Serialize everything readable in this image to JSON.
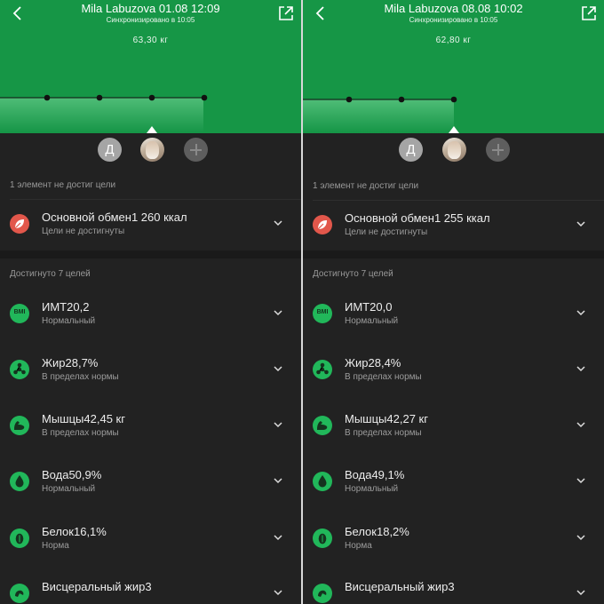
{
  "colors": {
    "header_green": "#169646",
    "goal_green": "#21b75a",
    "alert_red": "#e2574b",
    "background": "#222222"
  },
  "panels": [
    {
      "title": "Mila Labuzova 01.08 12:09",
      "sync": "Синхронизировано в 10:05",
      "weight": "63,30 кг",
      "avatar_initial": "Д",
      "not_reached_label": "1 элемент не достиг цели",
      "reached_label": "Достигнуто 7 целей",
      "alert": {
        "title": "Основной обмен",
        "value": "1 260 ккал",
        "status": "Цели не достигнуты",
        "icon": "leaf-icon"
      },
      "metrics": [
        {
          "title": "ИМТ",
          "value": "20,2",
          "status": "Нормальный",
          "icon": "bmi-icon",
          "icon_text": "BMI"
        },
        {
          "title": "Жир",
          "value": "28,7%",
          "status": "В пределах нормы",
          "icon": "fat-icon"
        },
        {
          "title": "Мышцы",
          "value": "42,45 кг",
          "status": "В пределах нормы",
          "icon": "muscle-icon"
        },
        {
          "title": "Вода",
          "value": "50,9%",
          "status": "Нормальный",
          "icon": "water-drop-icon"
        },
        {
          "title": "Белок",
          "value": "16,1%",
          "status": "Норма",
          "icon": "protein-icon"
        },
        {
          "title": "Висцеральный жир",
          "value": "3",
          "status": "",
          "icon": "visceral-fat-icon"
        }
      ]
    },
    {
      "title": "Mila Labuzova 08.08 10:02",
      "sync": "Синхронизировано в 10:05",
      "weight": "62,80 кг",
      "avatar_initial": "Д",
      "not_reached_label": "1 элемент не достиг цели",
      "reached_label": "Достигнуто 7 целей",
      "alert": {
        "title": "Основной обмен",
        "value": "1 255 ккал",
        "status": "Цели не достигнуты",
        "icon": "leaf-icon"
      },
      "metrics": [
        {
          "title": "ИМТ",
          "value": "20,0",
          "status": "Нормальный",
          "icon": "bmi-icon",
          "icon_text": "BMI"
        },
        {
          "title": "Жир",
          "value": "28,4%",
          "status": "В пределах нормы",
          "icon": "fat-icon"
        },
        {
          "title": "Мышцы",
          "value": "42,27 кг",
          "status": "В пределах нормы",
          "icon": "muscle-icon"
        },
        {
          "title": "Вода",
          "value": "49,1%",
          "status": "Нормальный",
          "icon": "water-drop-icon"
        },
        {
          "title": "Белок",
          "value": "18,2%",
          "status": "Норма",
          "icon": "protein-icon"
        },
        {
          "title": "Висцеральный жир",
          "value": "3",
          "status": "",
          "icon": "visceral-fat-icon"
        }
      ]
    }
  ]
}
